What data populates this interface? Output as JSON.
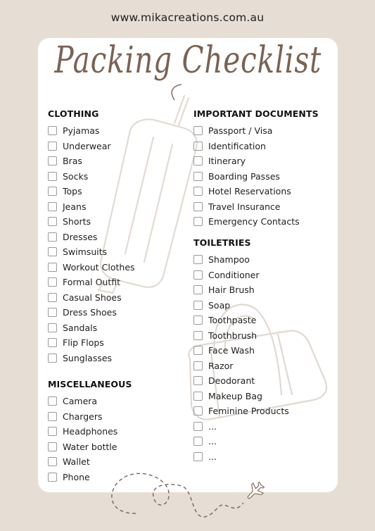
{
  "header": {
    "website": "www.mikacreations.com.au"
  },
  "title": "Packing Checklist",
  "colors": {
    "background": "#e6ded4",
    "card": "#ffffff",
    "accent": "#7a6355",
    "illustration": "#e4ddd6"
  },
  "sections": {
    "clothing": {
      "heading": "CLOTHING",
      "items": [
        "Pyjamas",
        "Underwear",
        "Bras",
        "Socks",
        "Tops",
        "Jeans",
        "Shorts",
        "Dresses",
        "Swimsuits",
        "Workout Clothes",
        "Formal Outfit",
        "Casual Shoes",
        "Dress Shoes",
        "Sandals",
        "Flip Flops",
        "Sunglasses"
      ]
    },
    "miscellaneous": {
      "heading": "MISCELLANEOUS",
      "items": [
        "Camera",
        "Chargers",
        "Headphones",
        "Water bottle",
        "Wallet",
        "Phone"
      ]
    },
    "documents": {
      "heading": "IMPORTANT DOCUMENTS",
      "items": [
        "Passport / Visa",
        "Identification",
        "Itinerary",
        "Boarding Passes",
        "Hotel Reservations",
        "Travel Insurance",
        "Emergency Contacts"
      ]
    },
    "toiletries": {
      "heading": "TOILETRIES",
      "items": [
        "Shampoo",
        "Conditioner",
        "Hair Brush",
        "Soap",
        "Toothpaste",
        "Toothbrush",
        "Face Wash",
        "Razor",
        "Deodorant",
        "Makeup Bag",
        "Feminine Products",
        "...",
        "...",
        "..."
      ]
    }
  },
  "icons": [
    "suitcase-illustration",
    "duffel-bag-illustration",
    "dashed-flight-path",
    "airplane-icon"
  ]
}
